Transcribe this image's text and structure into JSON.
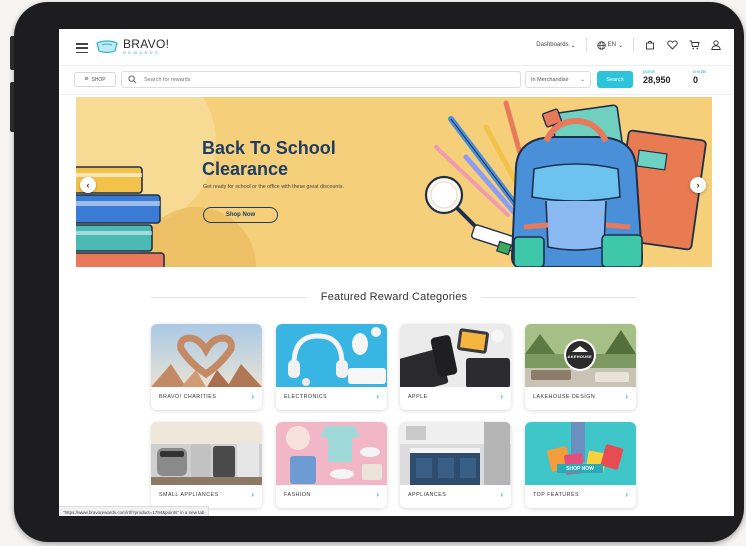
{
  "header": {
    "logo_text": "BRAVO!",
    "logo_sub": "REWARDS",
    "dashboards_label": "Dashboards",
    "language_label": "EN"
  },
  "searchbar": {
    "shop_label": "SHOP",
    "placeholder": "Search for rewards",
    "category_value": "In Merchandise",
    "search_label": "Search",
    "points_label": "points",
    "points_value": "28,950",
    "credits_label": "credits",
    "credits_value": "0"
  },
  "banner": {
    "title_line1": "Back To School",
    "title_line2": "Clearance",
    "subtitle": "Get ready for school or the office with these great discounts.",
    "cta": "Shop Now"
  },
  "featured": {
    "heading": "Featured Reward Categories",
    "categories": [
      {
        "label": "BRAVO! CHARITIES"
      },
      {
        "label": "ELECTRONICS"
      },
      {
        "label": "APPLE"
      },
      {
        "label": "LAKEHOUSE DESIGN"
      },
      {
        "label": "SMALL APPLIANCES"
      },
      {
        "label": "FASHION"
      },
      {
        "label": "APPLIANCES"
      },
      {
        "label": "TOP FEATURES"
      }
    ],
    "lakehouse_sign": "LAKEHOUSE",
    "top_features_badge": "SHOP NOW"
  },
  "status_bar": {
    "url_text": "\"https://www.bravorewards.com/rtl/?product=1794&points\" in a new tab"
  },
  "colors": {
    "accent": "#2cc4d8",
    "banner_bg": "#f5cf7a",
    "banner_title": "#1f3d63"
  }
}
